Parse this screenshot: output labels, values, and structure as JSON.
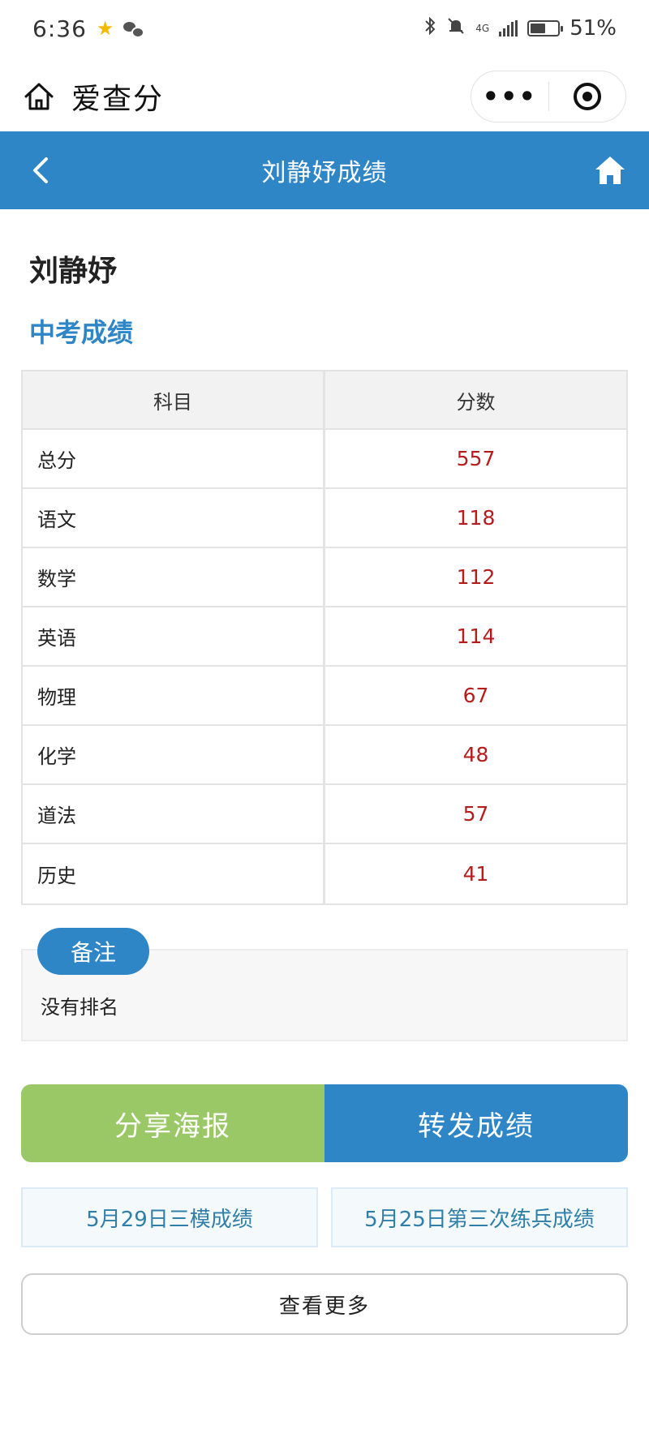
{
  "status_bar": {
    "time": "6:36",
    "battery": "51%",
    "network": "4G"
  },
  "mini_program": {
    "title": "爱查分",
    "more_label": "•••"
  },
  "header": {
    "title": "刘静妤成绩"
  },
  "student": {
    "name": "刘静妤"
  },
  "section_title": "中考成绩",
  "table": {
    "headers": [
      "科目",
      "分数"
    ],
    "rows": [
      {
        "subject": "总分",
        "score": "557"
      },
      {
        "subject": "语文",
        "score": "118"
      },
      {
        "subject": "数学",
        "score": "112"
      },
      {
        "subject": "英语",
        "score": "114"
      },
      {
        "subject": "物理",
        "score": "67"
      },
      {
        "subject": "化学",
        "score": "48"
      },
      {
        "subject": "道法",
        "score": "57"
      },
      {
        "subject": "历史",
        "score": "41"
      }
    ]
  },
  "remark": {
    "badge": "备注",
    "text": "没有排名"
  },
  "actions": {
    "share_poster": "分享海报",
    "forward_scores": "转发成绩"
  },
  "links": [
    "5月29日三模成绩",
    "5月25日第三次练兵成绩"
  ],
  "more_label": "查看更多",
  "colors": {
    "primary_blue": "#2f86c6",
    "share_green": "#9bc866",
    "score_red": "#b61c1c"
  }
}
